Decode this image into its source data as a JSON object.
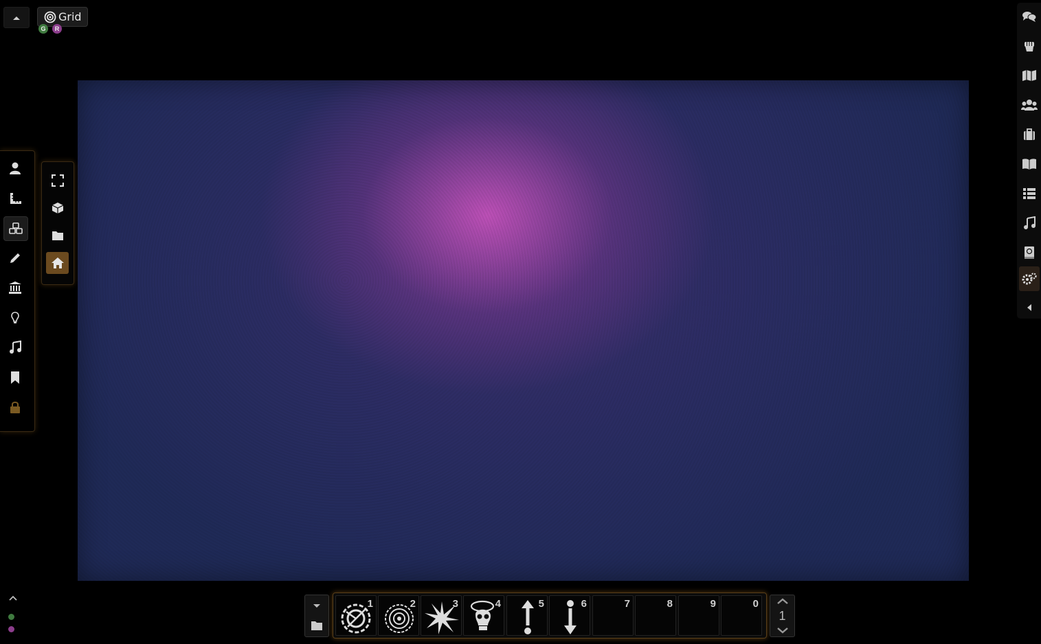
{
  "navigation": {
    "scene_label": "Grid",
    "users": [
      {
        "initial": "G",
        "color": "#3f7a3f"
      },
      {
        "initial": "R",
        "color": "#8c3d8c"
      }
    ]
  },
  "left_controls": [
    {
      "name": "token-controls",
      "icon": "user-icon"
    },
    {
      "name": "measure-controls",
      "icon": "ruler-icon"
    },
    {
      "name": "tile-controls",
      "icon": "cubes-icon",
      "active": true
    },
    {
      "name": "drawing-controls",
      "icon": "pencil-icon"
    },
    {
      "name": "wall-controls",
      "icon": "building-icon"
    },
    {
      "name": "lighting-controls",
      "icon": "lightbulb-icon"
    },
    {
      "name": "sound-controls",
      "icon": "music-icon"
    },
    {
      "name": "note-controls",
      "icon": "bookmark-icon"
    },
    {
      "name": "lock-controls",
      "icon": "lock-icon"
    }
  ],
  "left_sub_controls": [
    {
      "name": "fullscreen",
      "icon": "expand-icon"
    },
    {
      "name": "cube",
      "icon": "cube-icon"
    },
    {
      "name": "folder",
      "icon": "folder-icon"
    },
    {
      "name": "home",
      "icon": "home-icon",
      "active": true
    }
  ],
  "right_sidebar": [
    {
      "name": "chat",
      "icon": "comments-icon"
    },
    {
      "name": "combat",
      "icon": "fist-icon"
    },
    {
      "name": "scenes",
      "icon": "map-icon"
    },
    {
      "name": "actors",
      "icon": "users-icon"
    },
    {
      "name": "items",
      "icon": "suitcase-icon"
    },
    {
      "name": "journal",
      "icon": "book-open-icon"
    },
    {
      "name": "tables",
      "icon": "th-list-icon"
    },
    {
      "name": "playlists",
      "icon": "music-icon"
    },
    {
      "name": "compendium",
      "icon": "atlas-icon"
    },
    {
      "name": "settings",
      "icon": "cogs-icon",
      "active": true
    },
    {
      "name": "collapse",
      "icon": "caret-left-icon"
    }
  ],
  "players": [
    {
      "color": "#3f7a3f"
    },
    {
      "color": "#8c3d8c"
    }
  ],
  "hotbar": {
    "page": "1",
    "slots": [
      {
        "key": "1",
        "macro": "spiral-burst-icon"
      },
      {
        "key": "2",
        "macro": "vortex-icon"
      },
      {
        "key": "3",
        "macro": "starburst-icon"
      },
      {
        "key": "4",
        "macro": "skull-halo-icon"
      },
      {
        "key": "5",
        "macro": "arrow-up-icon"
      },
      {
        "key": "6",
        "macro": "arrow-down-icon"
      },
      {
        "key": "7",
        "macro": ""
      },
      {
        "key": "8",
        "macro": ""
      },
      {
        "key": "9",
        "macro": ""
      },
      {
        "key": "0",
        "macro": ""
      }
    ]
  },
  "colors": {
    "accent": "#6b4a1f",
    "hotbar_border": "#5a3f18",
    "canvas_base": "#232a5c",
    "canvas_highlight": "#c855bd"
  }
}
